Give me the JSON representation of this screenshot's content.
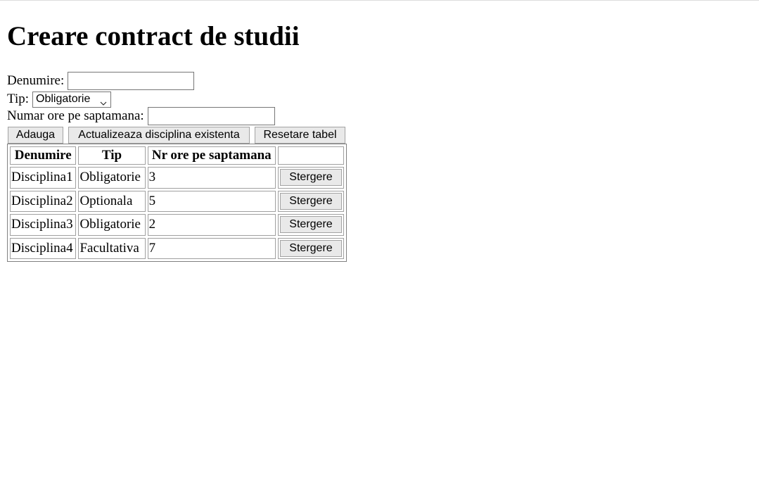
{
  "page": {
    "title": "Creare contract de studii"
  },
  "form": {
    "denumire_label": "Denumire:",
    "denumire_value": "",
    "tip_label": "Tip:",
    "tip_selected": "Obligatorie",
    "ore_label": "Numar ore pe saptamana:",
    "ore_value": ""
  },
  "buttons": {
    "adauga": "Adauga",
    "actualizeaza": "Actualizeaza disciplina existenta",
    "resetare": "Resetare tabel"
  },
  "table": {
    "headers": {
      "denumire": "Denumire",
      "tip": "Tip",
      "ore": "Nr ore pe saptamana",
      "actiune": ""
    },
    "rows": [
      {
        "denumire": "Disciplina1",
        "tip": "Obligatorie",
        "ore": "3",
        "action": "Stergere"
      },
      {
        "denumire": "Disciplina2",
        "tip": "Optionala",
        "ore": "5",
        "action": "Stergere"
      },
      {
        "denumire": "Disciplina3",
        "tip": "Obligatorie",
        "ore": "2",
        "action": "Stergere"
      },
      {
        "denumire": "Disciplina4",
        "tip": "Facultativa",
        "ore": "7",
        "action": "Stergere"
      }
    ]
  },
  "icons": {
    "select_chevron": "chevron-down-icon"
  }
}
